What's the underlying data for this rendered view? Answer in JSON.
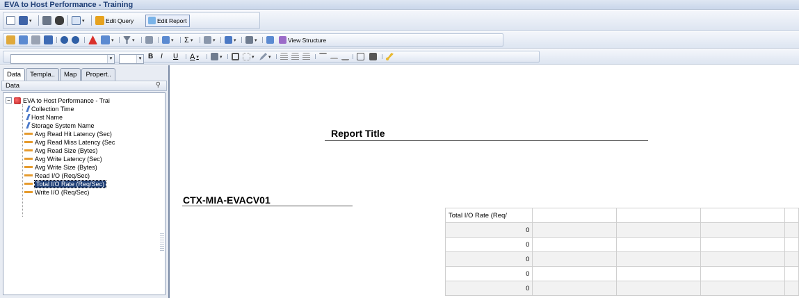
{
  "window": {
    "title": "EVA to Host Performance - Training"
  },
  "toolbar1": {
    "edit_query_label": "Edit Query",
    "edit_report_label": "Edit Report"
  },
  "toolbar2": {
    "view_structure_label": "View Structure"
  },
  "left_panel": {
    "tabs": [
      {
        "label": "Data",
        "active": true
      },
      {
        "label": "Templa..",
        "active": false
      },
      {
        "label": "Map",
        "active": false
      },
      {
        "label": "Propert..",
        "active": false
      }
    ],
    "header_label": "Data",
    "tree": {
      "root": "EVA to Host Performance - Trai",
      "items": [
        {
          "label": "Collection Time",
          "kind": "dimension"
        },
        {
          "label": "Host Name",
          "kind": "dimension"
        },
        {
          "label": "Storage System Name",
          "kind": "dimension"
        },
        {
          "label": "Avg Read Hit Latency (Sec)",
          "kind": "measure"
        },
        {
          "label": "Avg Read Miss Latency (Sec",
          "kind": "measure"
        },
        {
          "label": "Avg Read Size (Bytes)",
          "kind": "measure"
        },
        {
          "label": "Avg Write Latency (Sec)",
          "kind": "measure"
        },
        {
          "label": "Avg Write Size (Bytes)",
          "kind": "measure"
        },
        {
          "label": "Read I/O (Req/Sec)",
          "kind": "measure"
        },
        {
          "label": "Total I/O Rate (Req/Sec)",
          "kind": "measure",
          "selected": true
        },
        {
          "label": "Write I/O (Req/Sec)",
          "kind": "measure"
        }
      ]
    }
  },
  "report": {
    "title": "Report Title",
    "section_title": "CTX-MIA-EVACV01",
    "table": {
      "header": "Total I/O Rate (Req/",
      "rows": [
        "0",
        "0",
        "0",
        "0",
        "0"
      ]
    }
  },
  "colors": {
    "title_text": "#1f3f76",
    "selection": "#1f3f76",
    "measure_icon": "#e69b2e",
    "dimension_icon": "#4a78c9"
  }
}
